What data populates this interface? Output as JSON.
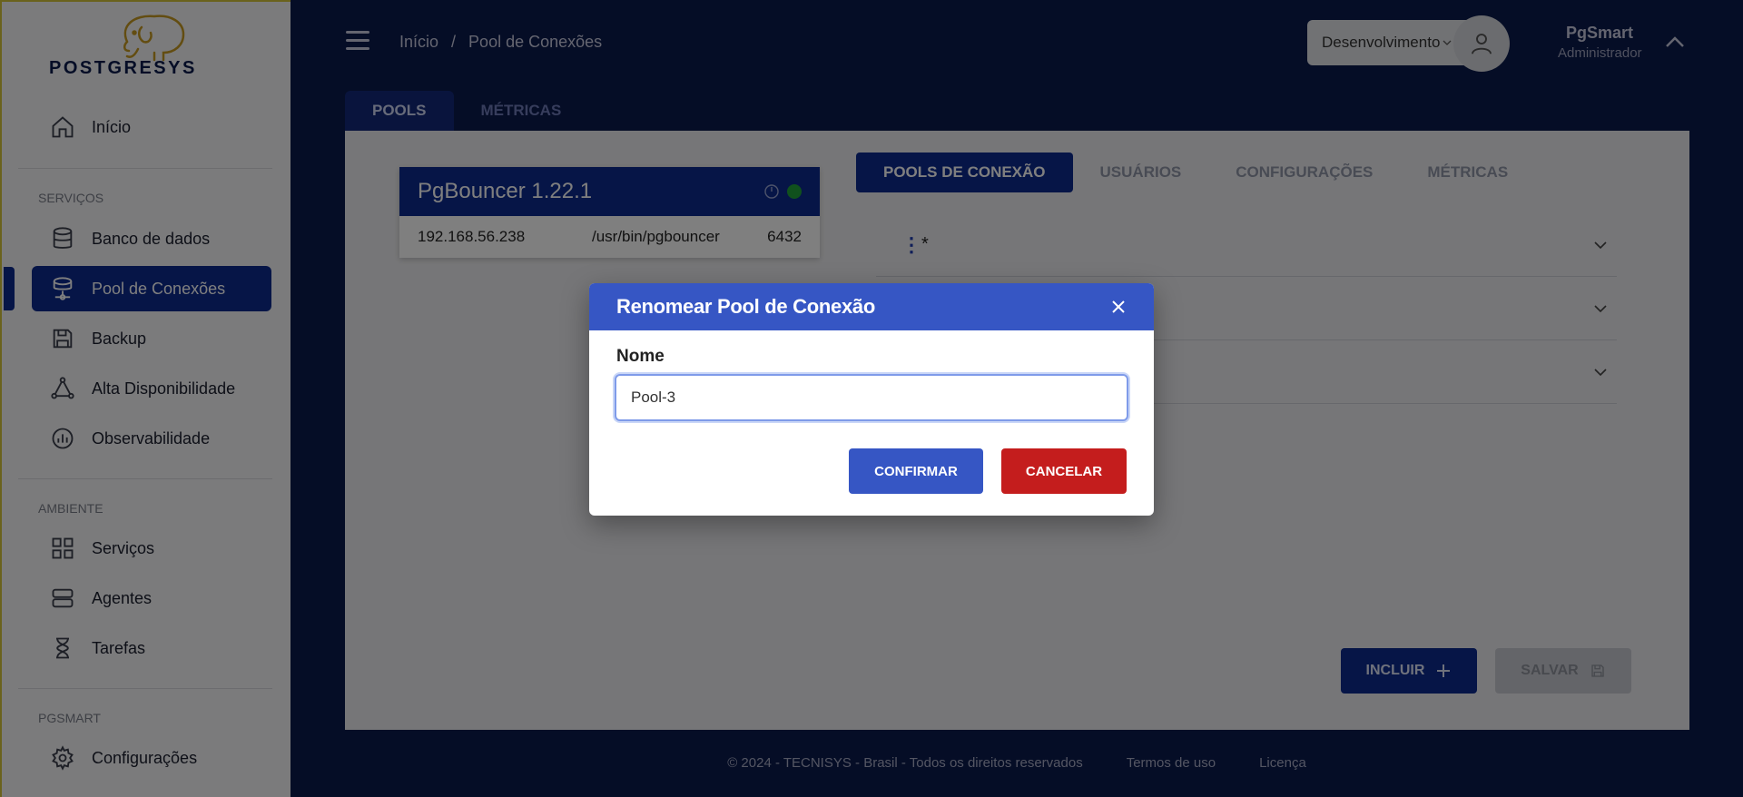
{
  "sidebar": {
    "logo_text": "POSTGRESYS",
    "items": [
      {
        "label": "Início",
        "icon": "home-icon"
      },
      {
        "label": "Banco de dados",
        "icon": "database-icon"
      },
      {
        "label": "Pool de Conexões",
        "icon": "connection-pool-icon",
        "active": true
      },
      {
        "label": "Backup",
        "icon": "save-icon"
      },
      {
        "label": "Alta Disponibilidade",
        "icon": "triangle-nodes-icon"
      },
      {
        "label": "Observabilidade",
        "icon": "chart-circle-icon"
      },
      {
        "label": "Serviços",
        "icon": "grid-icon"
      },
      {
        "label": "Agentes",
        "icon": "server-icon"
      },
      {
        "label": "Tarefas",
        "icon": "hourglass-icon"
      },
      {
        "label": "Configurações",
        "icon": "gear-icon"
      }
    ],
    "sections": [
      "SERVIÇOS",
      "AMBIENTE",
      "PGSMART"
    ]
  },
  "header": {
    "breadcrumb": [
      "Início",
      "/",
      "Pool de Conexões"
    ],
    "environment": "Desenvolvimento",
    "user_name": "PgSmart",
    "user_role": "Administrador"
  },
  "tabs": [
    "POOLS",
    "MÉTRICAS"
  ],
  "pgbouncer": {
    "title": "PgBouncer 1.22.1",
    "ip": "192.168.56.238",
    "path": "/usr/bin/pgbouncer",
    "port": "6432",
    "status_color": "#21a33a"
  },
  "inner_tabs": [
    "POOLS DE CONEXÃO",
    "USUÁRIOS",
    "CONFIGURAÇÕES",
    "MÉTRICAS"
  ],
  "pools": [
    {
      "name": "*"
    },
    {
      "name": ""
    },
    {
      "name": ""
    }
  ],
  "actions": {
    "include": "INCLUIR",
    "save": "SALVAR"
  },
  "footer": {
    "copyright": "© 2024 - TECNISYS - Brasil - Todos os direitos reservados",
    "terms": "Termos de uso",
    "license": "Licença"
  },
  "modal": {
    "title": "Renomear Pool de Conexão",
    "field_label": "Nome",
    "field_value": "Pool-3",
    "confirm": "CONFIRMAR",
    "cancel": "CANCELAR"
  },
  "colors": {
    "brand_dark": "#0d2a8f",
    "modal_primary": "#3656c4",
    "danger": "#c41d1d"
  }
}
